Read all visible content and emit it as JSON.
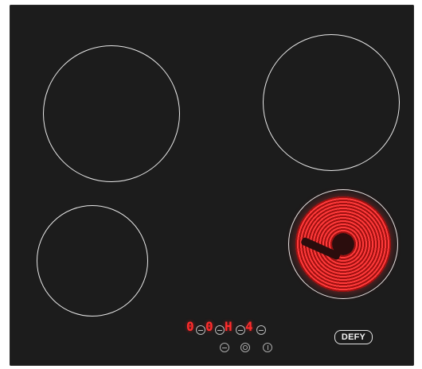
{
  "display": {
    "digits": [
      "0",
      "0",
      "H",
      "4"
    ]
  },
  "brand": {
    "name": "DEFY"
  },
  "icons": {
    "controls": [
      "zone-control-icon",
      "zone-control-icon",
      "zone-control-icon",
      "zone-control-icon"
    ],
    "bottom": [
      "minus-icon",
      "circle-icon",
      "power-icon"
    ]
  },
  "colors": {
    "glass": "#1c1c1c",
    "ring": "#e8e8e8",
    "heat": "#ff3a3a",
    "display": "#ff2c2c",
    "brand": "#f2f2f2"
  }
}
